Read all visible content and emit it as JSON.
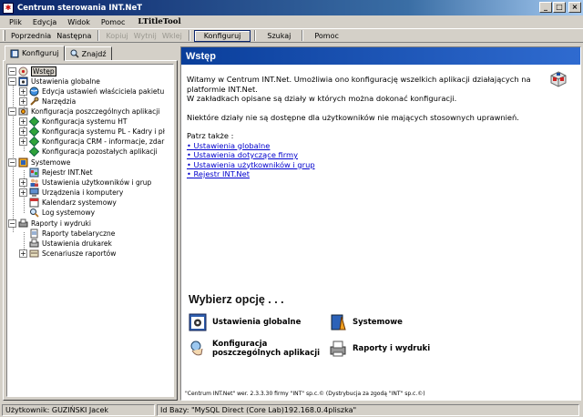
{
  "window": {
    "title": "Centrum sterowania INT.NeT"
  },
  "menu": {
    "items": [
      "Plik",
      "Edycja",
      "Widok",
      "Pomoc"
    ],
    "ltitle": "LTitleTool"
  },
  "toolbar": {
    "prev": "Poprzednia",
    "next": "Następna",
    "copy": "Kopiuj",
    "cut": "Wytnij",
    "paste": "Wklej",
    "configure": "Konfiguruj",
    "search": "Szukaj",
    "help": "Pomoc"
  },
  "left_tabs": {
    "configure": "Konfiguruj",
    "find": "Znajdź"
  },
  "tree": {
    "root": "Wstęp",
    "global": "Ustawienia globalne",
    "owner_edit": "Edycja ustawień właściciela pakietu",
    "tools": "Narzędzia",
    "apps": "Konfiguracja poszczególnych aplikacji",
    "ht": "Konfiguracja systemu HT",
    "pl": "Konfiguracja systemu PL - Kadry i pł",
    "crm": "Konfiguracja CRM - informacje, zdar",
    "other": "Konfiguracja pozostałych aplikacji",
    "systemowe": "Systemowe",
    "registry": "Rejestr INT.Net",
    "users": "Ustawienia użytkowników i grup",
    "devices": "Urządzenia i komputery",
    "calendar": "Kalendarz systemowy",
    "log": "Log systemowy",
    "reports": "Raporty i wydruki",
    "tabular": "Raporty tabelaryczne",
    "printers": "Ustawienia drukarek",
    "scenarios": "Scenariusze raportów"
  },
  "content": {
    "header": "Wstęp",
    "intro1": "Witamy w Centrum INT.Net. Umożliwia ono konfigurację wszelkich aplikacji działających na platformie INT.Net.",
    "intro2": "W zakładkach opisane są działy w których można dokonać konfiguracji.",
    "intro3": "Niektóre działy nie są dostępne dla użytkowników nie mających stosownych uprawnień.",
    "see_also": "Patrz także :",
    "links": [
      "Ustawienia globalne",
      "Ustawienia dotyczące firmy",
      "Ustawienia użytkowników i grup",
      "Rejestr INT.Net"
    ],
    "choose": "Wybierz opcję . . .",
    "opt_global": "Ustawienia globalne",
    "opt_system": "Systemowe",
    "opt_apps_1": "Konfiguracja",
    "opt_apps_2": "poszczególnych aplikacji",
    "opt_reports": "Raporty i wydruki",
    "footer": "\"Centrum INT.Net\" wer. 2.3.3.30 firmy \"INT\" sp.c.© (Dystrybucja za zgodą \"INT\" sp.c.©)"
  },
  "status": {
    "user": "Użytkownik: GUZIŃSKI Jacek",
    "db": "Id Bazy: \"MySQL Direct (Core Lab)192.168.0.4pliszka\""
  }
}
